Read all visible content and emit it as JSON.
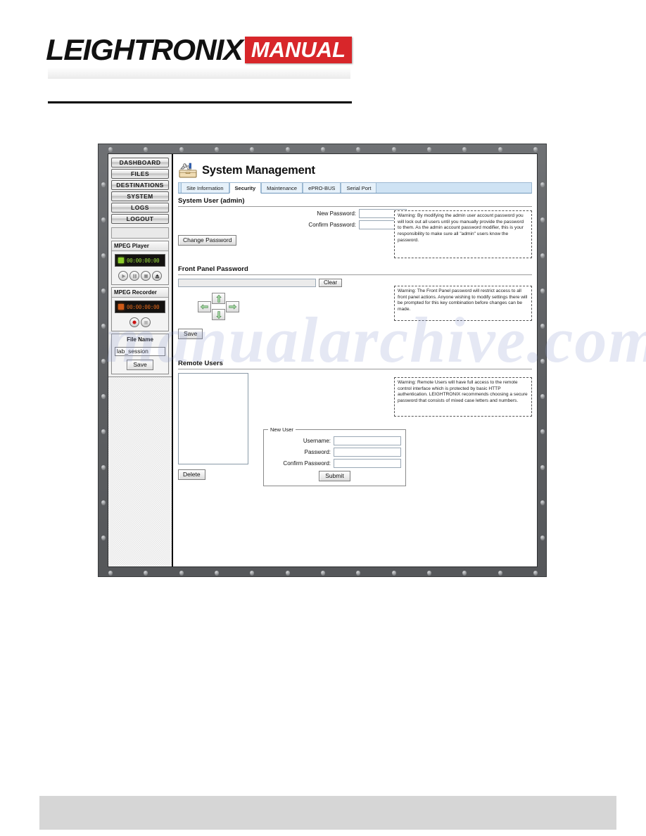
{
  "header": {
    "brand": "LEIGHTRONIX",
    "badge": "MANUAL"
  },
  "sidebar": {
    "nav_items": [
      {
        "label": "DASHBOARD"
      },
      {
        "label": "FILES"
      },
      {
        "label": "DESTINATIONS"
      },
      {
        "label": "SYSTEM"
      },
      {
        "label": "LOGS"
      },
      {
        "label": "LOGOUT"
      }
    ],
    "mpeg_player": {
      "title": "MPEG Player",
      "timecode": "00:00:00:00",
      "led_color": "#8ccd2a",
      "buttons": [
        {
          "name": "play-button"
        },
        {
          "name": "pause-button"
        },
        {
          "name": "stop-button"
        },
        {
          "name": "eject-button"
        }
      ]
    },
    "mpeg_recorder": {
      "title": "MPEG Recorder",
      "timecode": "00:00:00:00",
      "led_color": "#cf5a17",
      "buttons": [
        {
          "name": "record-button"
        },
        {
          "name": "stop-button"
        }
      ]
    },
    "file_name": {
      "label": "File Name",
      "value": "lab_session",
      "placeholder": "",
      "save_label": "Save"
    }
  },
  "main": {
    "title": "System Management",
    "icon": "toolbox-icon",
    "tabs": [
      {
        "label": "Site Information",
        "active": false
      },
      {
        "label": "Security",
        "active": true
      },
      {
        "label": "Maintenance",
        "active": false
      },
      {
        "label": "ePRO-BUS",
        "active": false
      },
      {
        "label": "Serial Port",
        "active": false
      }
    ],
    "system_user": {
      "heading": "System User (admin)",
      "new_password_label": "New Password:",
      "new_password_value": "",
      "confirm_password_label": "Confirm Password:",
      "confirm_password_value": "",
      "change_password_label": "Change Password",
      "warning": "Warning:  By modifying the admin user account password you will lock out all users until you manually provide the password to them.  As the admin account password modifier, this is your responsibility to make sure all \"admin\" users know the password."
    },
    "front_panel": {
      "heading": "Front Panel Password",
      "password_value": "",
      "clear_label": "Clear",
      "save_label": "Save",
      "arrows": [
        {
          "name": "arrow-left-button",
          "glyph": "left"
        },
        {
          "name": "arrow-up-button",
          "glyph": "up"
        },
        {
          "name": "arrow-down-button",
          "glyph": "down"
        },
        {
          "name": "arrow-right-button",
          "glyph": "right"
        }
      ],
      "warning": "Warning: The Front Panel password will restrict access to all front panel actions. Anyone wishing to modify settings there will be prompted for this key combination before changes can be made."
    },
    "remote_users": {
      "heading": "Remote Users",
      "list_items": [],
      "delete_label": "Delete",
      "new_user_legend": "New User",
      "username_label": "Username:",
      "username_value": "",
      "password_label": "Password:",
      "password_value": "",
      "confirm_password_label": "Confirm Password:",
      "confirm_password_value": "",
      "submit_label": "Submit",
      "warning": "Warning:  Remote Users will have full access to the remote control interface which is protected by basic HTTP authentication.  LEIGHTRONIX recommends choosing a secure password that consists of mixed case letters and numbers."
    }
  },
  "watermark": {
    "text": "manualarchive.com"
  },
  "colors": {
    "brand_red": "#d8262a",
    "bezel": "#5f6164",
    "tab_bar": "#cfe3f4",
    "led_green": "#8ccd2a",
    "led_orange": "#cf5a17"
  }
}
